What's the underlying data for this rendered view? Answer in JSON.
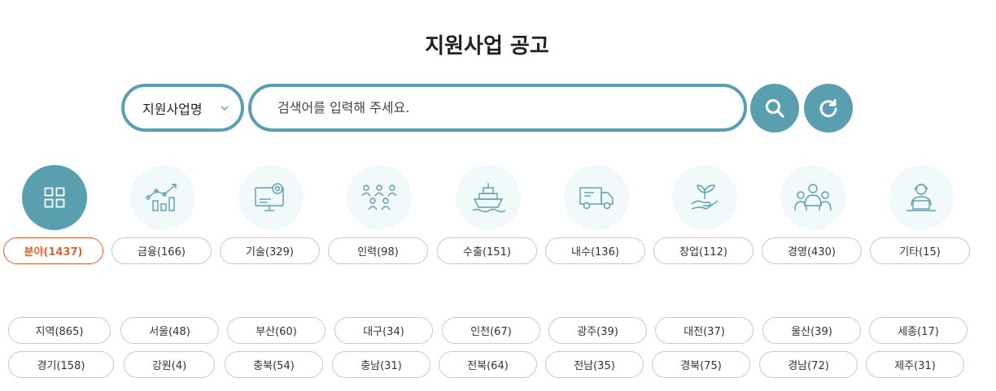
{
  "page": {
    "title": "지원사업 공고"
  },
  "search": {
    "select_value": "지원사업명",
    "placeholder": "검색어를 입력해 주세요.",
    "search_icon": "search-icon",
    "reset_icon": "refresh-icon"
  },
  "colors": {
    "accent": "#5a9fb0",
    "active": "#e0622f",
    "icon_bg": "#f1f9fa"
  },
  "categories": [
    {
      "label": "분야(1437)",
      "icon": "grid-icon",
      "active": true
    },
    {
      "label": "금융(166)",
      "icon": "chart-icon"
    },
    {
      "label": "기술(329)",
      "icon": "tech-monitor-icon"
    },
    {
      "label": "인력(98)",
      "icon": "people-icon"
    },
    {
      "label": "수출(151)",
      "icon": "ship-icon"
    },
    {
      "label": "내수(136)",
      "icon": "truck-icon"
    },
    {
      "label": "창업(112)",
      "icon": "sprout-hand-icon"
    },
    {
      "label": "경영(430)",
      "icon": "management-team-icon"
    },
    {
      "label": "기타(15)",
      "icon": "person-laptop-icon"
    }
  ],
  "regions": {
    "row1": [
      "지역(865)",
      "서울(48)",
      "부산(60)",
      "대구(34)",
      "인천(67)",
      "광주(39)",
      "대전(37)",
      "울산(39)",
      "세종(17)"
    ],
    "row2": [
      "경기(158)",
      "강원(4)",
      "충북(54)",
      "충남(31)",
      "전북(64)",
      "전남(35)",
      "경북(75)",
      "경남(72)",
      "제주(31)"
    ]
  }
}
